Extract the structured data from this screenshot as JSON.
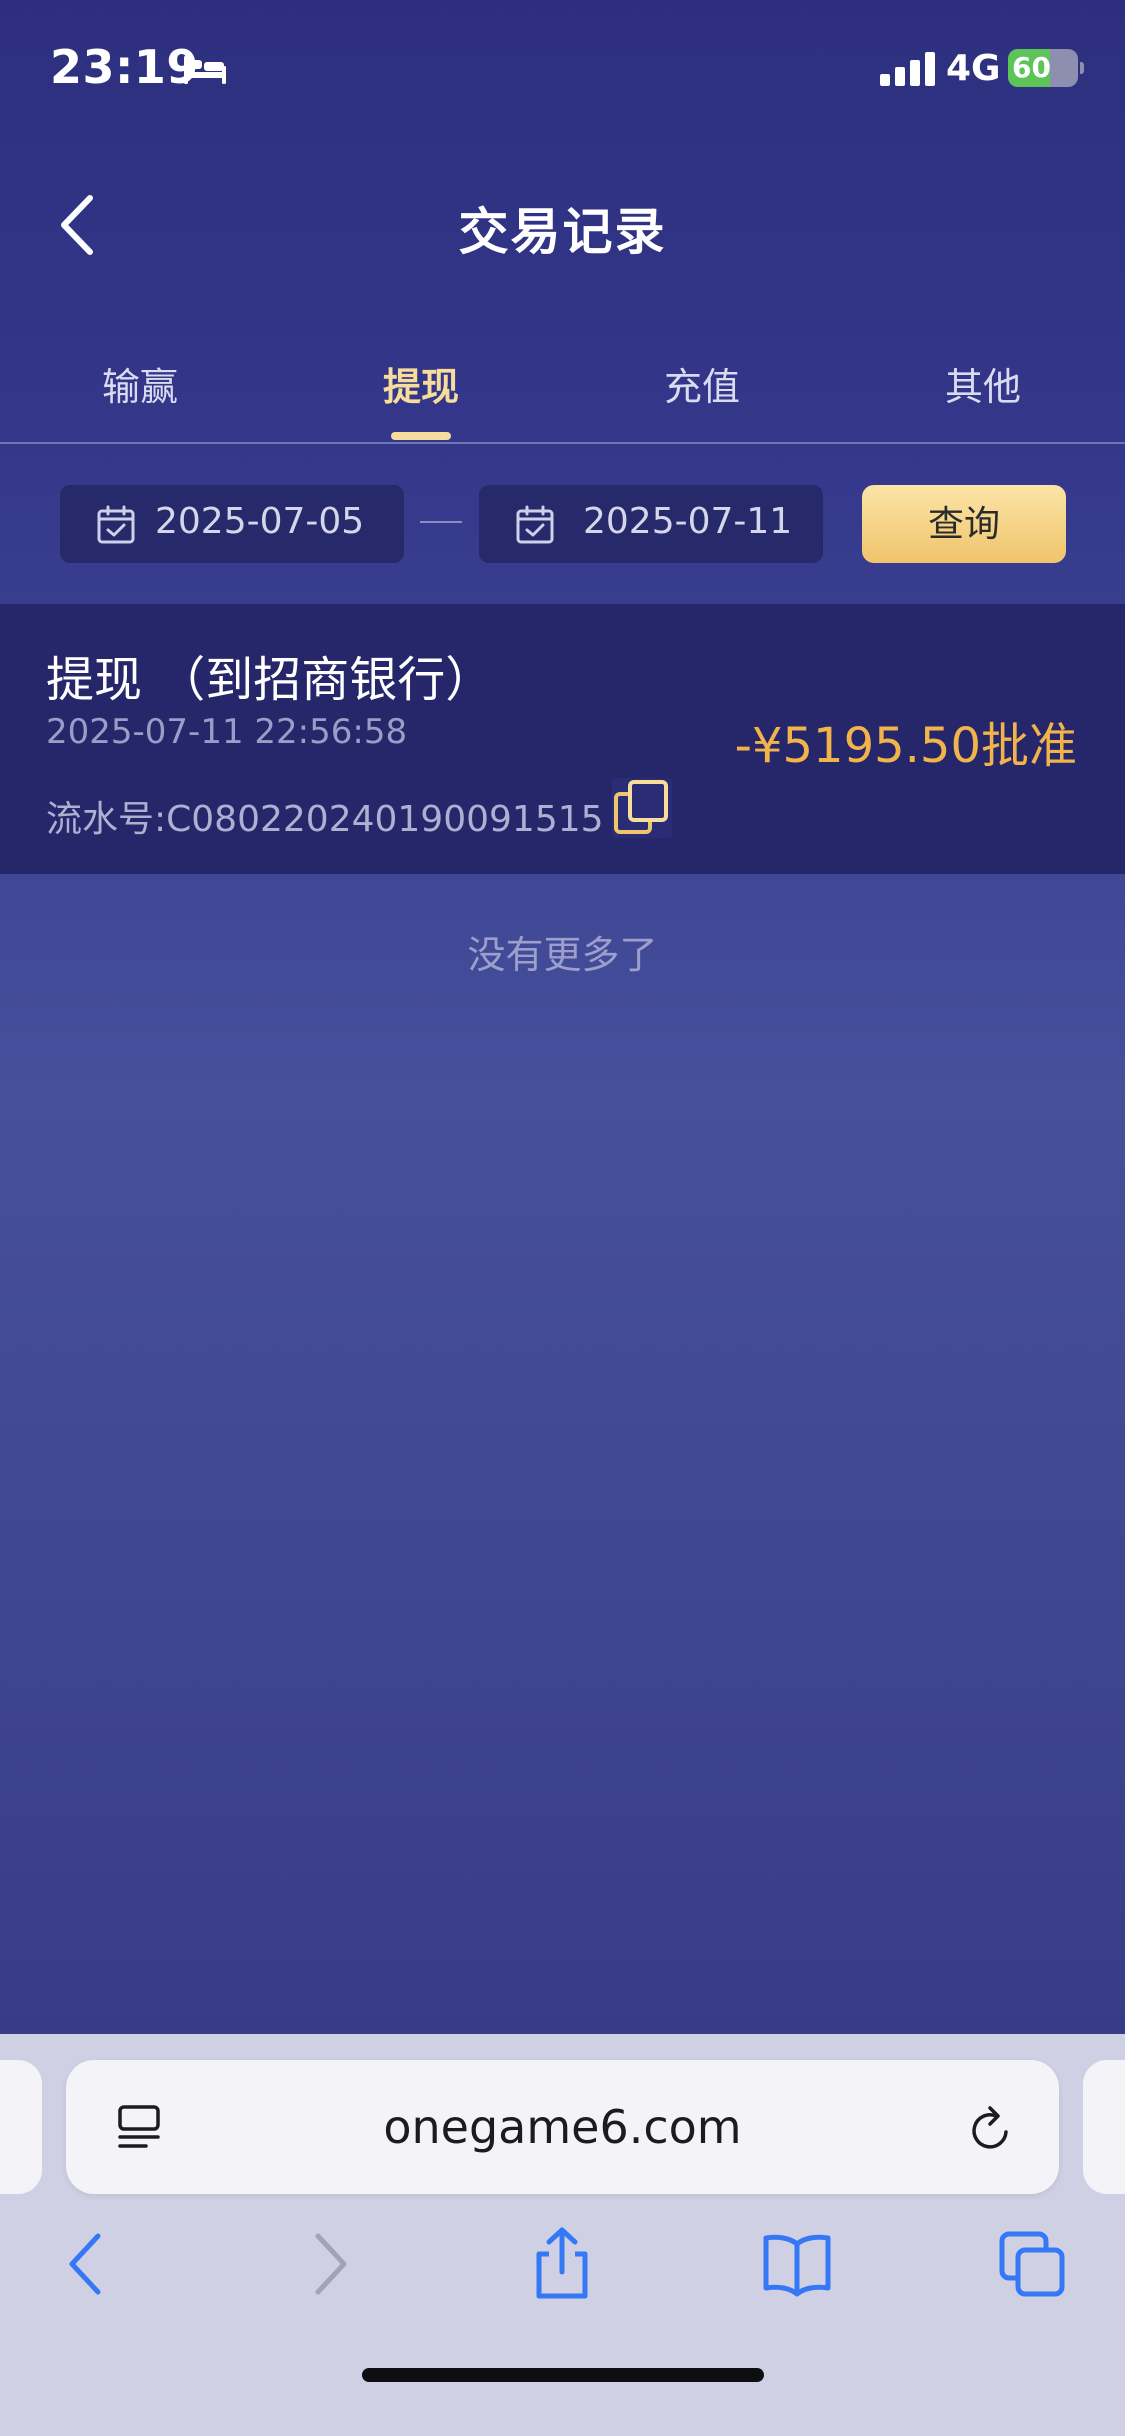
{
  "status_bar": {
    "time": "23:19",
    "network": "4G",
    "battery": "60",
    "battery_level": 0.6,
    "icons": [
      "sleep-bed-icon",
      "cellular-signal-icon",
      "battery-charging-icon"
    ]
  },
  "header": {
    "title": "交易记录",
    "back_icon": "chevron-left-icon"
  },
  "tabs": [
    {
      "label": "输赢",
      "active": false
    },
    {
      "label": "提现",
      "active": true
    },
    {
      "label": "充值",
      "active": false
    },
    {
      "label": "其他",
      "active": false
    }
  ],
  "filter": {
    "start_date": "2025-07-05",
    "end_date": "2025-07-11",
    "separator": "—",
    "query_label": "查询",
    "date_icon": "calendar-check-icon"
  },
  "records": [
    {
      "title": "提现 （到招商银行）",
      "time": "2025-07-11 22:56:58",
      "serial": "流水号:C080220240190091515",
      "amount": "-¥5195.50批准",
      "copy_icon": "copy-icon"
    }
  ],
  "list_footer": "没有更多了",
  "browser": {
    "url": "onegame6.com",
    "icons": [
      "reader-icon",
      "reload-icon",
      "back-arrow-icon",
      "forward-arrow-icon",
      "share-icon",
      "bookmarks-icon",
      "tabs-icon"
    ]
  },
  "colors": {
    "accent_gold": "#f7dd9b",
    "amount_orange": "#f2b44a",
    "bg_navy": "#2d2f7e"
  }
}
